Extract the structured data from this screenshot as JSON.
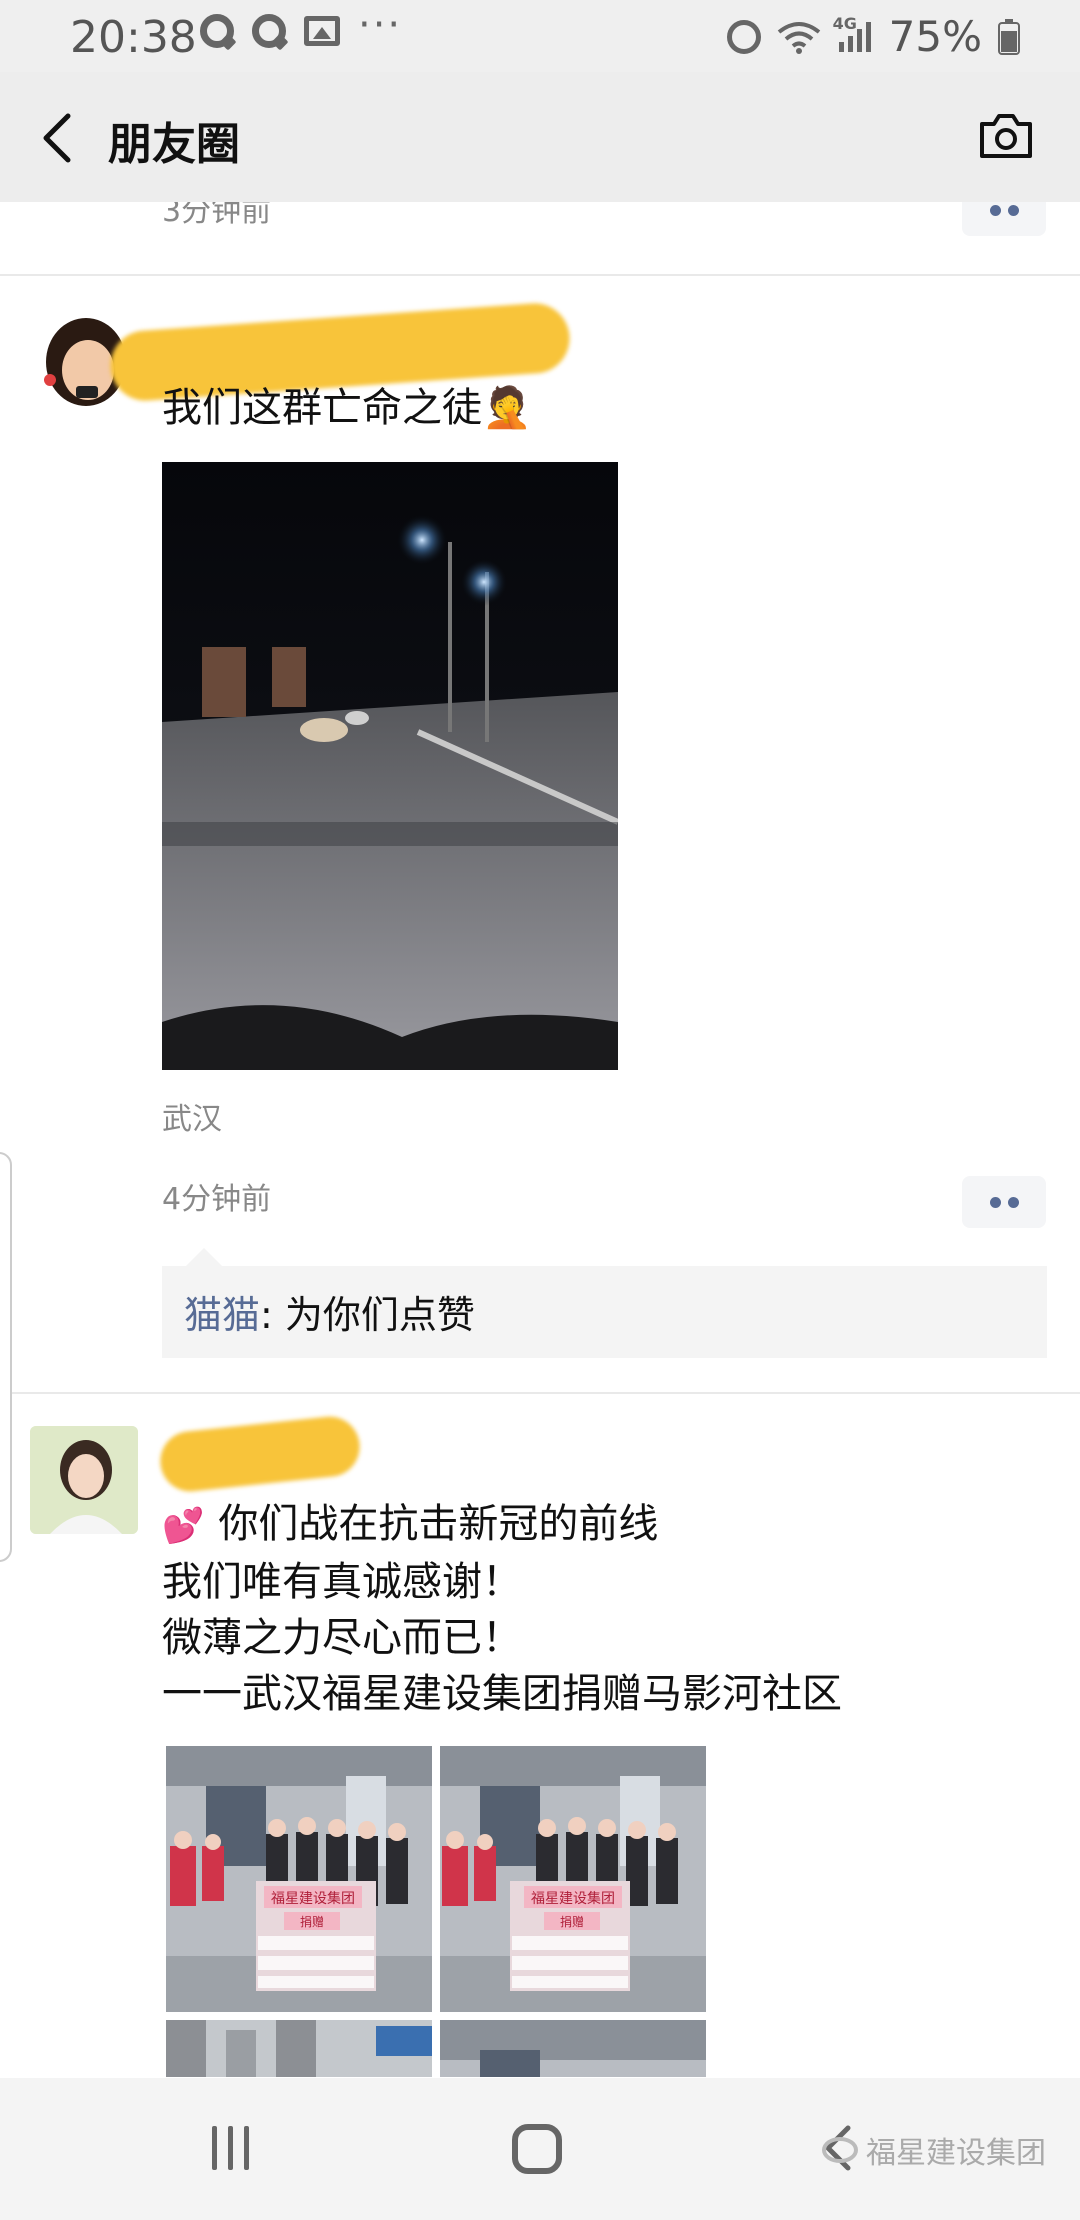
{
  "status_bar": {
    "time": "20:38",
    "network": "4G",
    "battery": "75%"
  },
  "header": {
    "title": "朋友圈"
  },
  "previous_post": {
    "time": "3分钟前"
  },
  "post1": {
    "text": "我们这群亡命之徒",
    "emoji": "🤦",
    "location": "武汉",
    "time": "4分钟前",
    "comment_author": "猫猫",
    "comment_sep": ": ",
    "comment_text": "为你们点赞"
  },
  "post2": {
    "line1_emoji": "💕",
    "line1": "你们战在抗击新冠的前线",
    "line2": "我们唯有真诚感谢！",
    "line3": "微薄之力尽心而已！",
    "line4": "一一武汉福星建设集团捐赠马影河社区",
    "banner_text": "福星建设集团",
    "banner_sub": "捐赠"
  },
  "watermark": {
    "text": "福星建设集团"
  },
  "colors": {
    "link": "#576b95",
    "name_blur": "#f8c43a"
  }
}
